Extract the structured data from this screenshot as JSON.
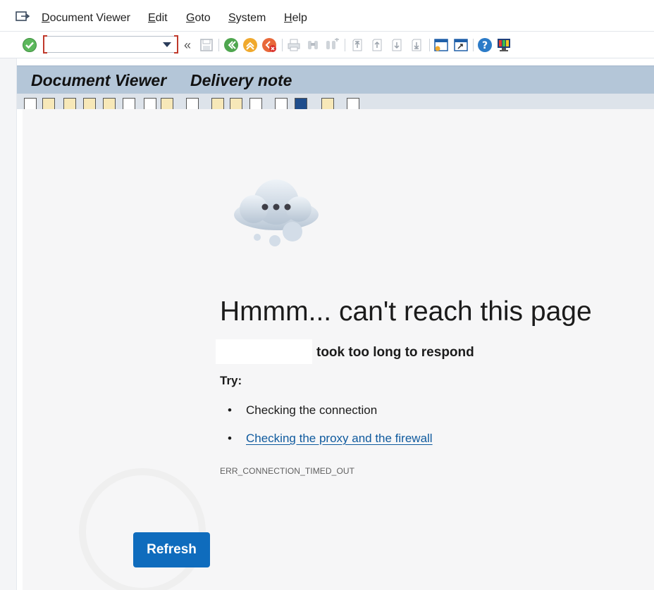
{
  "menu": {
    "items": [
      {
        "mnemonic": "D",
        "rest": "ocument Viewer"
      },
      {
        "mnemonic": "E",
        "rest": "dit"
      },
      {
        "mnemonic": "G",
        "rest": "oto"
      },
      {
        "mnemonic": "S",
        "rest": "ystem"
      },
      {
        "mnemonic": "H",
        "rest": "elp"
      }
    ]
  },
  "toolbar": {
    "command_field_value": "",
    "collapse_symbol": "«"
  },
  "header": {
    "app_title": "Document Viewer",
    "doc_title": "Delivery note"
  },
  "error_page": {
    "title": "Hmmm... can't reach this page",
    "message": "took too long to respond",
    "try_label": "Try:",
    "bullet_symbol": "•",
    "suggestions": [
      {
        "text": "Checking the connection",
        "is_link": false
      },
      {
        "text": "Checking the proxy and the firewall",
        "is_link": true
      }
    ],
    "error_code": "ERR_CONNECTION_TIMED_OUT",
    "refresh_label": "Refresh"
  },
  "colors": {
    "header_bg": "#b4c6d8",
    "link": "#0f5a9e",
    "refresh_button": "#0f6cbd",
    "pane_bg": "#f6f6f7"
  },
  "icons": [
    "enter-check-icon",
    "save-icon",
    "back-icon",
    "exit-icon",
    "cancel-icon",
    "print-icon",
    "find-icon",
    "find-next-icon",
    "first-page-icon",
    "previous-page-icon",
    "next-page-icon",
    "last-page-icon",
    "create-session-icon",
    "shortcut-icon",
    "help-icon",
    "customize-layout-icon"
  ]
}
